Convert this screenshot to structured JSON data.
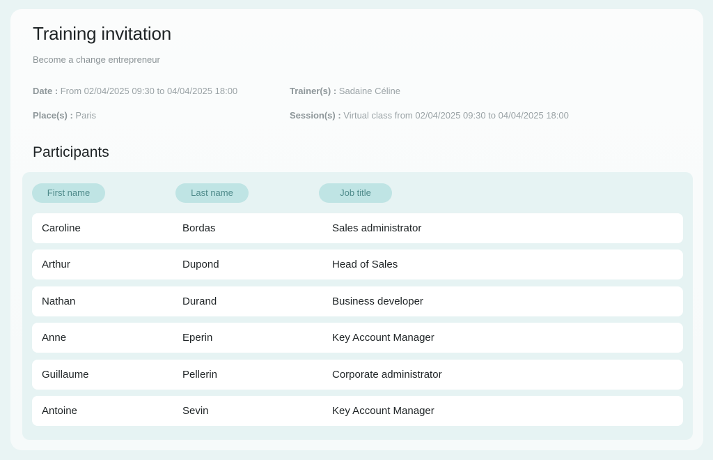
{
  "header": {
    "title": "Training invitation",
    "subtitle": "Become a change entrepreneur"
  },
  "details": {
    "date_label": "Date :",
    "date_value": " From 02/04/2025 09:30 to 04/04/2025 18:00",
    "place_label": "Place(s) :",
    "place_value": " Paris",
    "trainer_label": "Trainer(s) :",
    "trainer_value": " Sadaine Céline",
    "session_label": "Session(s) :",
    "session_value": " Virtual class from 02/04/2025 09:30 to 04/04/2025 18:00"
  },
  "participants": {
    "title": "Participants",
    "columns": [
      "First name",
      "Last name",
      "Job title"
    ],
    "rows": [
      [
        "Caroline",
        "Bordas",
        "Sales administrator"
      ],
      [
        "Arthur",
        "Dupond",
        "Head of Sales"
      ],
      [
        "Nathan",
        "Durand",
        "Business developer"
      ],
      [
        "Anne",
        "Eperin",
        "Key Account Manager"
      ],
      [
        "Guillaume",
        "Pellerin",
        "Corporate administrator"
      ],
      [
        "Antoine",
        "Sevin",
        "Key Account Manager"
      ]
    ]
  },
  "colors": {
    "header_pill_bg": "#bfe4e4",
    "header_pill_text": "#4f8b8b",
    "table_bg": "#e6f3f3"
  }
}
